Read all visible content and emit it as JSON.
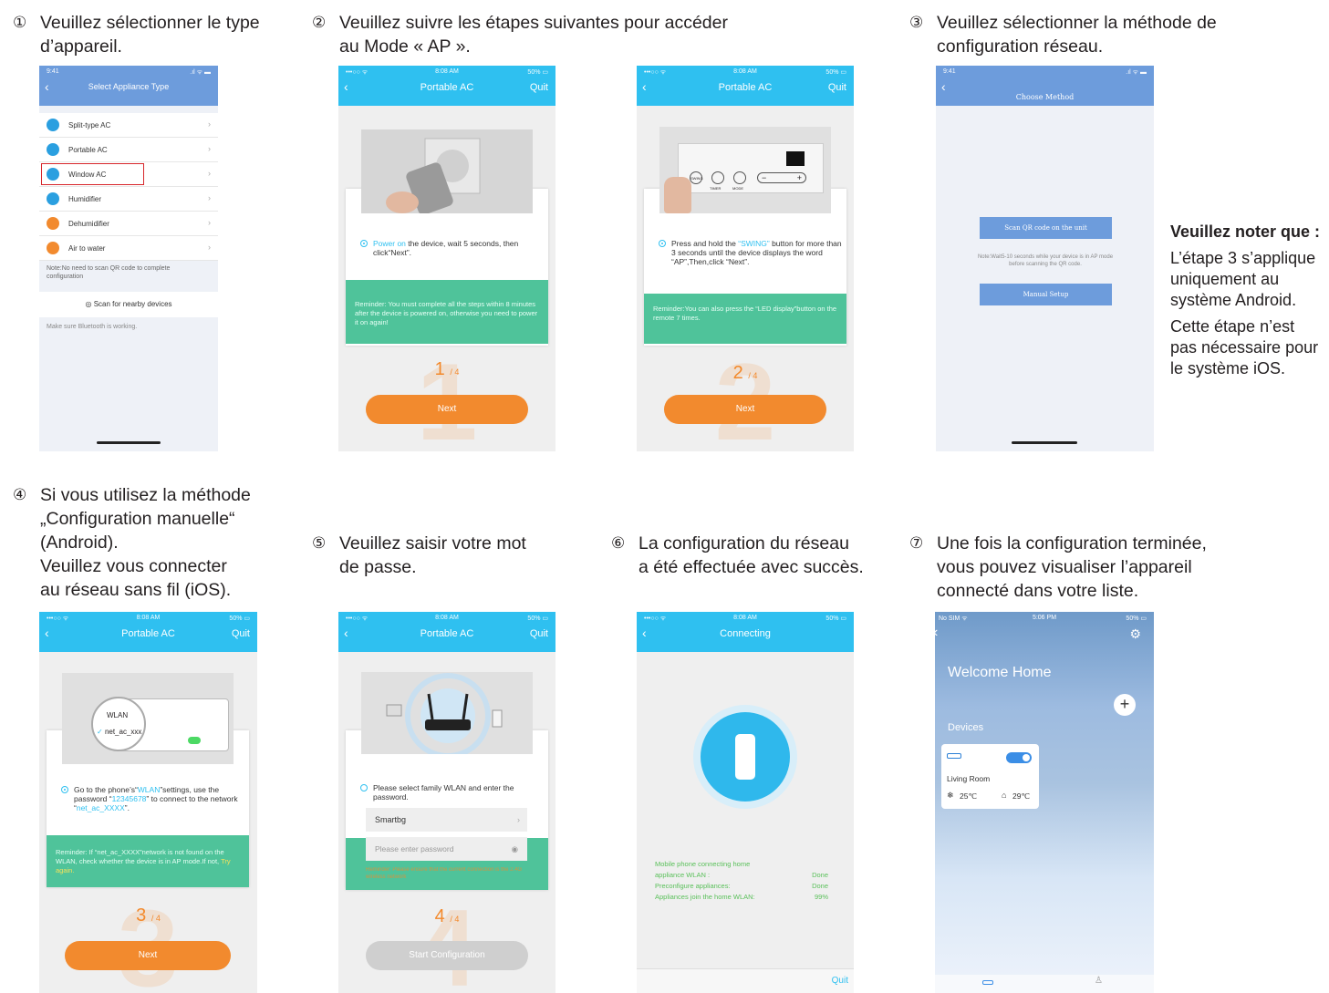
{
  "captions": {
    "c1_num": "①",
    "c1_line1": "Veuillez sélectionner le type",
    "c1_line2": "d’appareil.",
    "c2_num": "②",
    "c2_line1": "Veuillez suivre les étapes suivantes pour accéder",
    "c2_line2": "au Mode « AP ».",
    "c3_num": "③",
    "c3_line1": "Veuillez sélectionner la méthode de",
    "c3_line2": "configuration réseau.",
    "c4_num": "④",
    "c4_line1": "Si vous utilisez la méthode",
    "c4_line2": "„Configuration manuelle“",
    "c4_line3": "(Android).",
    "c4_line4": "Veuillez vous connecter",
    "c4_line5": "au réseau sans fil (iOS).",
    "c5_num": "⑤",
    "c5_line1": "Veuillez saisir votre mot",
    "c5_line2": "de passe.",
    "c6_num": "⑥",
    "c6_line1": "La configuration du réseau",
    "c6_line2": "a été effectuée avec succès.",
    "c7_num": "⑦",
    "c7_line1": "Une fois la configuration terminée,",
    "c7_line2": "vous pouvez visualiser l’appareil",
    "c7_line3": "connecté dans votre liste."
  },
  "note": {
    "title": "Veuillez noter que :",
    "p1": "L’étape 3 s’applique uniquement au système Android.",
    "p2": "Cette étape n’est pas nécessaire pour le système iOS."
  },
  "status": {
    "time_941": "9:41",
    "time_808": "8:08 AM",
    "time_506": "5:06 PM",
    "carrier": "•••○○ ᯤ",
    "battery": "50% ▭",
    "nosim": "No SIM ᯤ",
    "signal": ".ıl ᯤ ▬"
  },
  "s1": {
    "title": "Select Appliance Type",
    "items": [
      "Split-type AC",
      "Portable AC",
      "Window AC",
      "Humidifier",
      "Dehumidifier",
      "Air to water"
    ],
    "note": "Note:No need to scan QR code to complete configuration",
    "scan": "Scan for nearby devices",
    "bt": "Make sure Bluetooth is working."
  },
  "common": {
    "portable_ac": "Portable AC",
    "quit": "Quit",
    "next": "Next",
    "back": "‹"
  },
  "s2a": {
    "hl": "Power on",
    "text": " the device, wait 5 seconds, then click“Next”.",
    "reminder": "Reminder: You must complete all the steps within 8 minutes after the device is powered on, otherwise you need to power it on again!",
    "step": "1",
    "of": "4",
    "big": "1"
  },
  "s2b": {
    "pre": "Press and hold the ",
    "hl": "“SWING”",
    "text": " button for more than 3 seconds until the device displays the word “AP”,Then,click “Next”.",
    "reminder": "Reminder:You can also press the “LED display”button on the remote 7 times.",
    "step": "2",
    "of": "4",
    "big": "2",
    "panel_timer": "TIMER",
    "panel_mode": "MODE",
    "panel_swing": "SWING",
    "minus": "−",
    "plus": "+"
  },
  "s3": {
    "title": "Choose Method",
    "scan_btn": "Scan QR code on the unit",
    "note": "Note:Wait5-10 seconds while your device is in AP mode before scanning the QR code.",
    "manual_btn": "Manual Setup"
  },
  "s4": {
    "pre": "Go to the phone’s“",
    "hl1": "WLAN",
    "mid1": "”settings, use the password “",
    "hl2": "12345678",
    "mid2": "” to connect to the network “",
    "hl3": "net_ac_XXXX",
    "end": "”.",
    "reminder": "Reminder: If “net_ac_XXXX”network is not found on the WLAN, check whether the device is in AP mode.If not, ",
    "try": "Try again.",
    "wlan": "WLAN",
    "net": "net_ac_xxx",
    "step": "3",
    "of": "4",
    "big": "3"
  },
  "s5": {
    "text": "Please select family WLAN and enter the password.",
    "ssid": "Smartbg",
    "pw_placeholder": "Please enter password",
    "reminder": "Reminder: Please ensure that the current connection is the 2.4G wireless network",
    "step": "4",
    "of": "4",
    "big": "4",
    "start": "Start Configuration"
  },
  "s6": {
    "title": "Connecting",
    "rows": [
      {
        "label": "Mobile phone connecting home appliance WLAN :",
        "value": "Done"
      },
      {
        "label": "Preconfigure appliances:",
        "value": "Done"
      },
      {
        "label": "Appliances join the home WLAN:",
        "value": "99%"
      }
    ]
  },
  "s7": {
    "welcome": "Welcome Home",
    "devices": "Devices",
    "room": "Living Room",
    "temp1": "25℃",
    "temp2": "29℃"
  },
  "colors": {
    "cyan": "#2fc0f0",
    "orange": "#f28a2e",
    "green": "#4fc39a",
    "blue_bar": "#6d9cdc"
  }
}
